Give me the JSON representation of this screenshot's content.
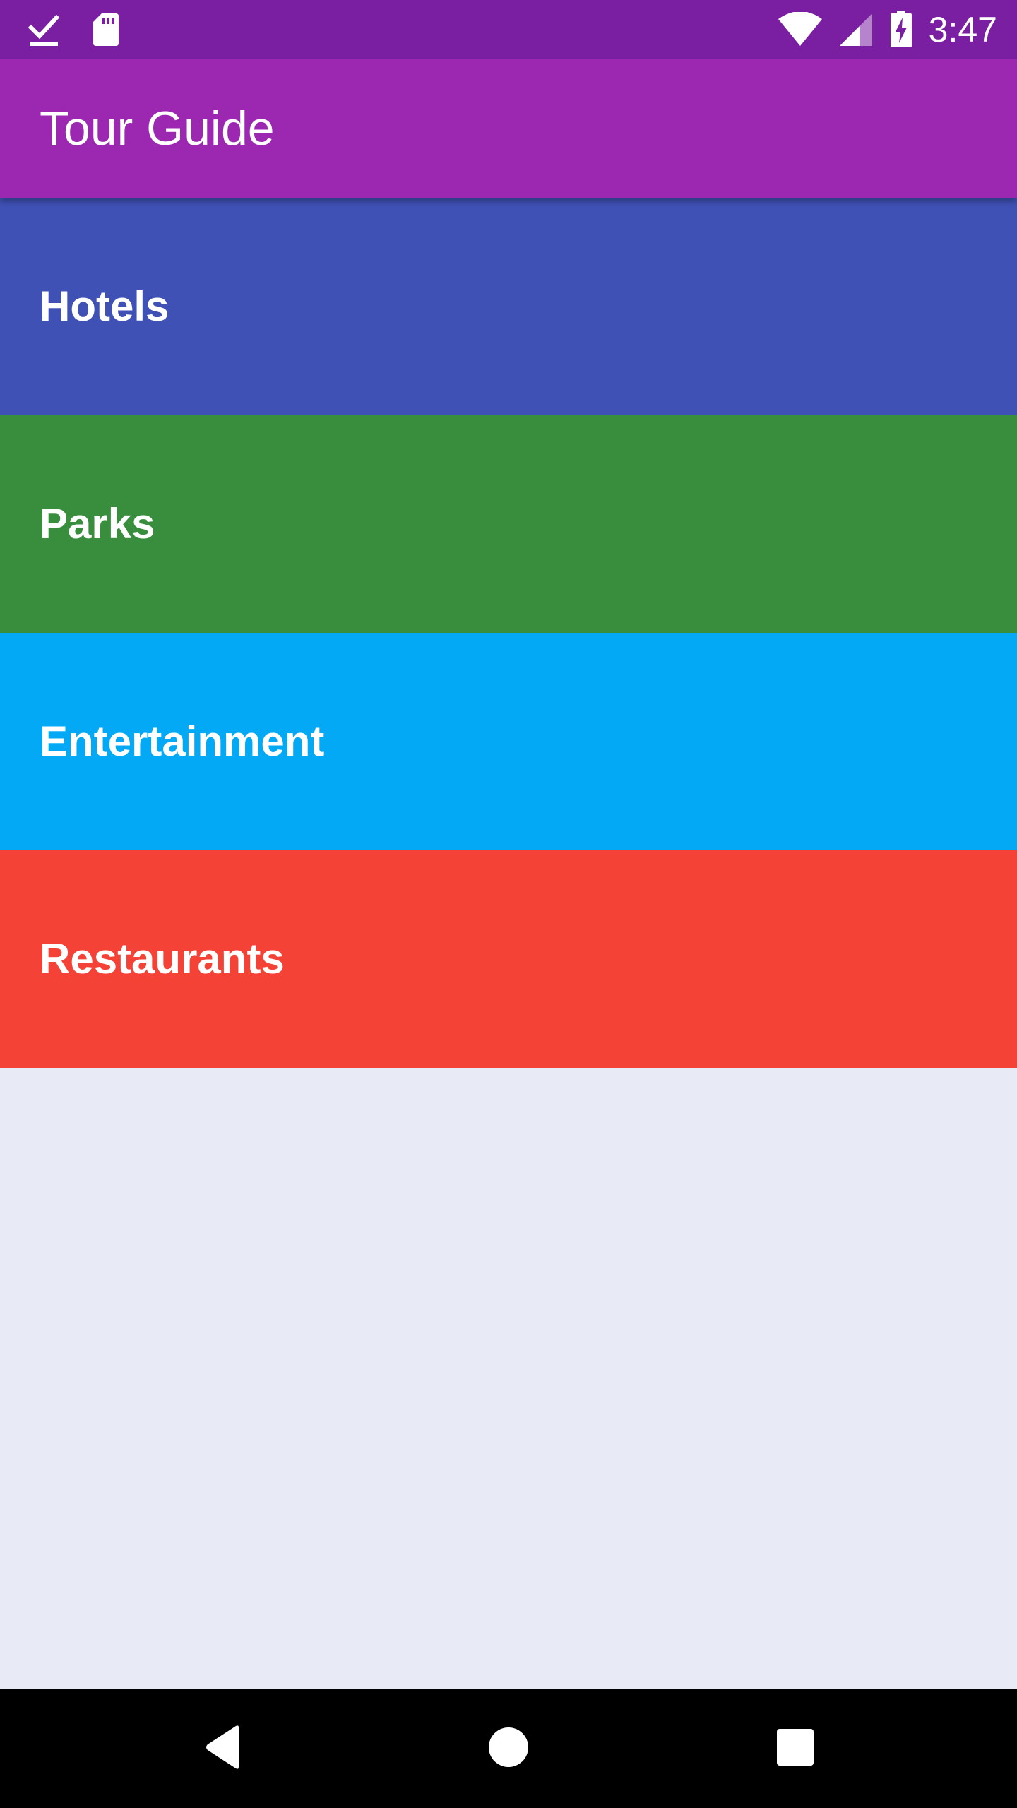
{
  "status_bar": {
    "time": "3:47",
    "background": "#7B1FA2",
    "left_icons": [
      "download-done-icon",
      "sd-card-icon"
    ],
    "right_icons": [
      "wifi-icon",
      "cell-signal-icon",
      "battery-charging-icon"
    ]
  },
  "app_bar": {
    "title": "Tour Guide",
    "background": "#9C27B0"
  },
  "categories": [
    {
      "label": "Hotels",
      "color": "#3F51B5"
    },
    {
      "label": "Parks",
      "color": "#388E3C"
    },
    {
      "label": "Entertainment",
      "color": "#03A9F4"
    },
    {
      "label": "Restaurants",
      "color": "#F44336"
    }
  ],
  "content_background": "#E8EAF6",
  "nav_bar": {
    "buttons": [
      "back-icon",
      "home-icon",
      "recents-icon"
    ]
  }
}
